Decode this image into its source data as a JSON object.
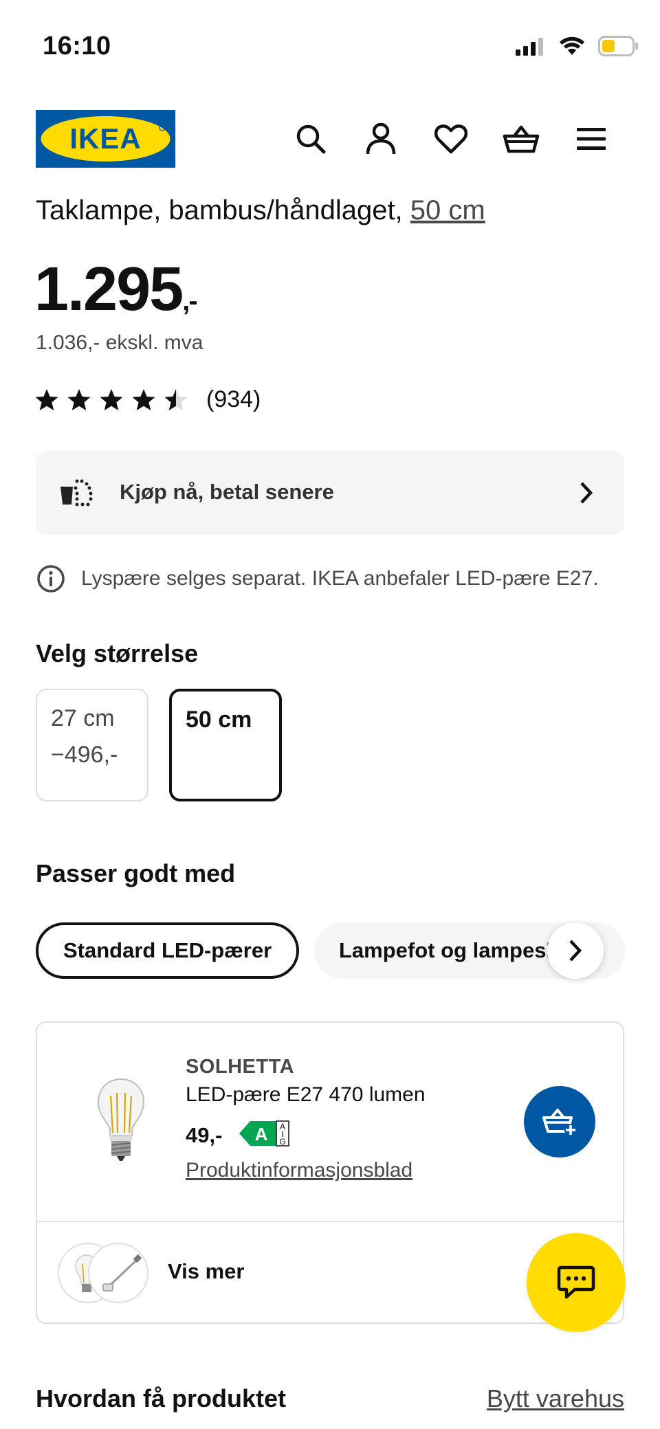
{
  "status_bar": {
    "time": "16:10"
  },
  "header": {
    "logo_text": "IKEA",
    "brand_blue": "#0058a3",
    "brand_yellow": "#ffdb00"
  },
  "product": {
    "title_prefix": "Taklampe, bambus/håndlaget, ",
    "title_size": "50 cm",
    "price_main": "1.295",
    "price_suffix": ",-",
    "price_ex_vat": "1.036,- ekskl. mva",
    "rating": 4.5,
    "rating_count": "(934)"
  },
  "klarna": {
    "label": "Kjøp nå, betal senere"
  },
  "notice": {
    "text": "Lyspære selges separat. IKEA anbefaler LED-pære E27."
  },
  "size_section": {
    "title": "Velg størrelse",
    "options": [
      {
        "label": "27 cm",
        "diff": "−496,-",
        "selected": false
      },
      {
        "label": "50 cm",
        "diff": "",
        "selected": true
      }
    ]
  },
  "goes_with": {
    "title": "Passer godt med",
    "tabs": [
      {
        "label": "Standard LED-pærer",
        "active": true
      },
      {
        "label": "Lampefot og lampeskjerm",
        "active": false
      }
    ]
  },
  "recommended": {
    "name": "SOLHETTA",
    "description": "LED-pære E27 470 lumen",
    "price": "49,-",
    "energy_class": "A",
    "energy_scale_top": "A",
    "energy_scale_bottom": "G",
    "energy_color": "#00a651",
    "info_link": "Produktinformasjonsblad",
    "more_label": "Vis mer"
  },
  "delivery": {
    "title": "Hvordan få produktet",
    "change_store": "Bytt varehus"
  }
}
